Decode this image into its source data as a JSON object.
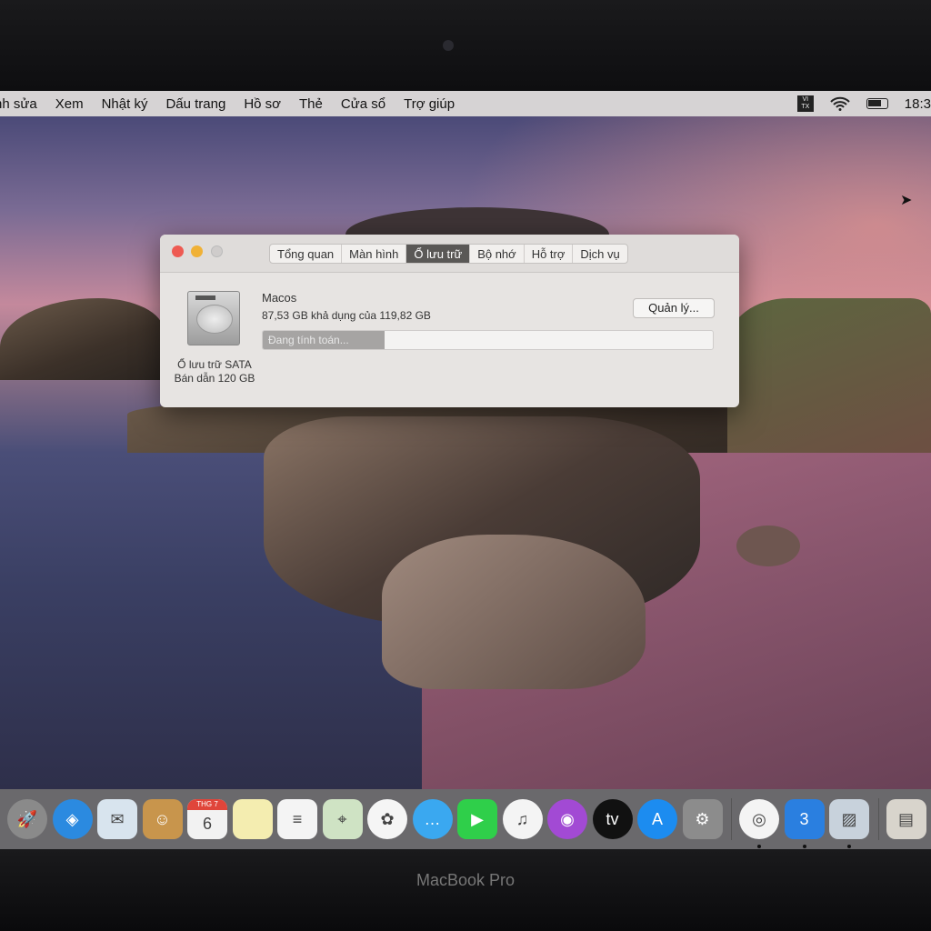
{
  "menubar": {
    "items": [
      "nh sửa",
      "Xem",
      "Nhật ký",
      "Dấu trang",
      "Hồ sơ",
      "Thẻ",
      "Cửa sổ",
      "Trợ giúp"
    ],
    "status": {
      "input_method": [
        "VI",
        "TX"
      ],
      "wifi_icon": "wifi-icon",
      "battery_icon": "battery-icon",
      "clock": "18:3"
    }
  },
  "window": {
    "tabs": [
      "Tổng quan",
      "Màn hình",
      "Ổ lưu trữ",
      "Bộ nhớ",
      "Hỗ trợ",
      "Dịch vụ"
    ],
    "active_tab": "Ổ lưu trữ",
    "disk_caption": [
      "Ổ lưu trữ SATA",
      "Bán dẫn 120 GB"
    ],
    "volume_name": "Macos",
    "volume_avail": "87,53 GB khả dụng của 119,82 GB",
    "manage_button": "Quản lý...",
    "progress_label": "Đang tính toán...",
    "progress_fraction": 0.27
  },
  "dock": {
    "apps": [
      {
        "name": "launchpad",
        "glyph": "🚀",
        "bg": "#8a8a8a",
        "round": true
      },
      {
        "name": "safari",
        "glyph": "◈",
        "bg": "#2b8ae0",
        "round": true
      },
      {
        "name": "mail",
        "glyph": "✉",
        "bg": "#d8e4ee"
      },
      {
        "name": "contacts",
        "glyph": "☺",
        "bg": "#c8954c"
      },
      {
        "name": "calendar",
        "glyph": "6",
        "bg": "#f2f2f2",
        "label": "THG 7"
      },
      {
        "name": "notes",
        "glyph": "",
        "bg": "#f4edb0"
      },
      {
        "name": "reminders",
        "glyph": "≡",
        "bg": "#f4f4f4"
      },
      {
        "name": "maps",
        "glyph": "⌖",
        "bg": "#cfe3c4"
      },
      {
        "name": "photos",
        "glyph": "✿",
        "bg": "#f5f5f5",
        "round": true
      },
      {
        "name": "messages",
        "glyph": "…",
        "bg": "#3aa8f0",
        "round": true
      },
      {
        "name": "facetime",
        "glyph": "▶",
        "bg": "#2fcf4a"
      },
      {
        "name": "music",
        "glyph": "♫",
        "bg": "#f4f4f4",
        "round": true
      },
      {
        "name": "podcasts",
        "glyph": "◉",
        "bg": "#a24ad4",
        "round": true
      },
      {
        "name": "apple-tv",
        "glyph": "tv",
        "bg": "#111",
        "round": true
      },
      {
        "name": "app-store",
        "glyph": "A",
        "bg": "#1c8cf0",
        "round": true
      },
      {
        "name": "system-preferences",
        "glyph": "⚙",
        "bg": "#8c8c8c"
      }
    ],
    "recent": [
      {
        "name": "chrome",
        "glyph": "◎",
        "bg": "#f4f4f4",
        "round": true
      },
      {
        "name": "css3",
        "glyph": "3",
        "bg": "#2a7fe0"
      },
      {
        "name": "preview",
        "glyph": "▨",
        "bg": "#c8d2dc"
      }
    ],
    "trash": {
      "name": "documents",
      "glyph": "▤",
      "bg": "#d8d4cc"
    }
  },
  "bezel": {
    "brand": "MacBook Pro"
  },
  "colors": {
    "close": "#ee5a52",
    "minimize": "#f0b136",
    "zoom": "#cfcccb"
  }
}
